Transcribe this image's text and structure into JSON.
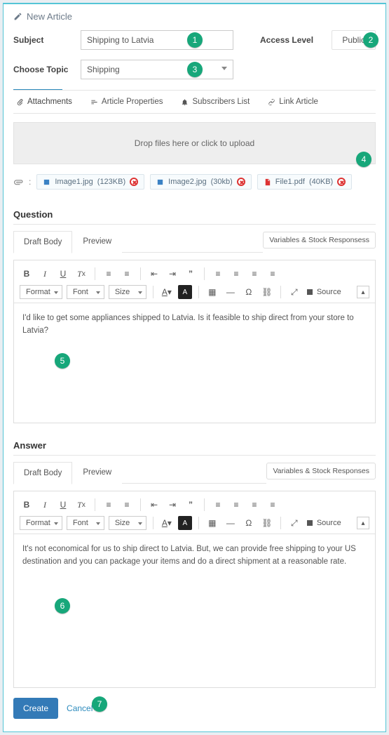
{
  "window_title": "New Article",
  "fields": {
    "subject_label": "Subject",
    "subject_value": "Shipping to Latvia",
    "access_label": "Access Level",
    "access_value": "Public",
    "topic_label": "Choose Topic",
    "topic_value": "Shipping"
  },
  "subtabs": {
    "attachments": "Attachments",
    "properties": "Article Properties",
    "subscribers": "Subscribers List",
    "link": "Link Article"
  },
  "dropzone": "Drop files here or click to upload",
  "attachments": [
    {
      "name": "Image1.jpg",
      "size": "(123KB)",
      "type": "image"
    },
    {
      "name": "Image2.jpg",
      "size": "(30kb)",
      "type": "image"
    },
    {
      "name": "File1.pdf",
      "size": "(40KB)",
      "type": "pdf"
    }
  ],
  "sections": {
    "question": "Question",
    "answer": "Answer"
  },
  "tabs": {
    "draft": "Draft Body",
    "preview": "Preview"
  },
  "vars_btn_q": "Variables & Stock Responsess",
  "vars_btn_a": "Variables & Stock Responses",
  "toolbar": {
    "format": "Format",
    "font": "Font",
    "size": "Size",
    "source": "Source"
  },
  "question_body": "I'd like to get some appliances shipped to Latvia. Is it feasible to ship direct from your store to Latvia?",
  "answer_body": "It's not economical for us to ship direct to Latvia. But, we can provide free shipping to your US destination and you can package your items and do a direct shipment at a reasonable rate.",
  "footer": {
    "create": "Create",
    "cancel": "Cancel"
  },
  "badges": {
    "b1": "1",
    "b2": "2",
    "b3": "3",
    "b4": "4",
    "b5": "5",
    "b6": "6",
    "b7": "7"
  },
  "colon": ":"
}
